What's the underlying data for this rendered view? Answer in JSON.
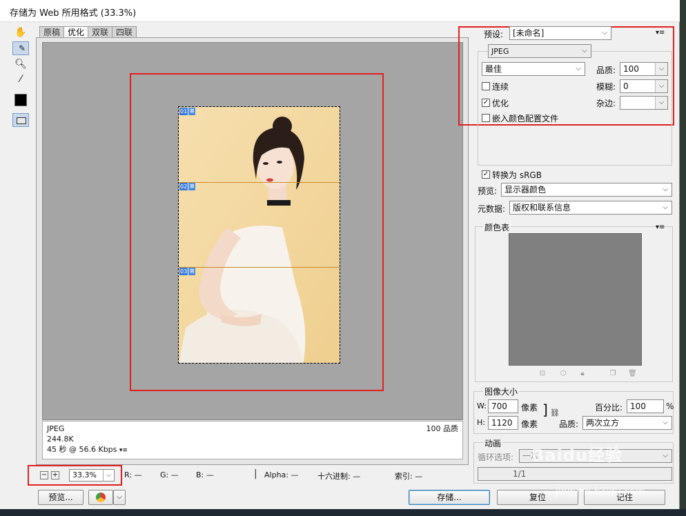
{
  "window": {
    "title": "存储为 Web 所用格式 (33.3%)"
  },
  "tabs": [
    "原稿",
    "优化",
    "双联",
    "四联"
  ],
  "slices": [
    "01",
    "02",
    "03"
  ],
  "info": {
    "format": "JPEG",
    "size": "244.8K",
    "time": "45 秒 @ 56.6 Kbps",
    "quality_right": "100 品质"
  },
  "status": {
    "zoom": "33.3%",
    "r": "R: —",
    "g": "G: —",
    "b": "B: —",
    "alpha": "Alpha: —",
    "hex": "十六进制: —",
    "index": "索引: —"
  },
  "buttons": {
    "preview": "预览...",
    "save": "存储...",
    "reset": "复位",
    "remember": "记住"
  },
  "settings": {
    "preset_label": "预设:",
    "preset_value": "[未命名]",
    "format": "JPEG",
    "quality_preset": "最佳",
    "quality_label": "品质:",
    "quality_value": "100",
    "progressive": "连续",
    "blur_label": "模糊:",
    "blur_value": "0",
    "optimized": "优化",
    "matte_label": "杂边:",
    "matte_value": "",
    "embed_profile": "嵌入颜色配置文件",
    "convert_srgb": "转换为 sRGB",
    "preview_label": "预览:",
    "preview_value": "显示器颜色",
    "metadata_label": "元数据:",
    "metadata_value": "版权和联系信息",
    "color_table": "颜色表"
  },
  "image_size": {
    "title": "图像大小",
    "w_label": "W:",
    "w_value": "700",
    "w_unit": "像素",
    "h_label": "H:",
    "h_value": "1120",
    "h_unit": "像素",
    "percent_label": "百分比:",
    "percent_value": "100",
    "percent_unit": "%",
    "quality_label": "品质:",
    "quality_value": "两次立方"
  },
  "animation": {
    "title": "动画",
    "loop_label": "循环选项:",
    "loop_value": "一次",
    "frame": "1/1"
  },
  "checkboxes": {
    "progressive": false,
    "optimized": true,
    "embed_profile": false,
    "convert_srgb": true
  },
  "watermark": {
    "text": "Baidu经验",
    "sub": "jingyan.baidu.com"
  }
}
